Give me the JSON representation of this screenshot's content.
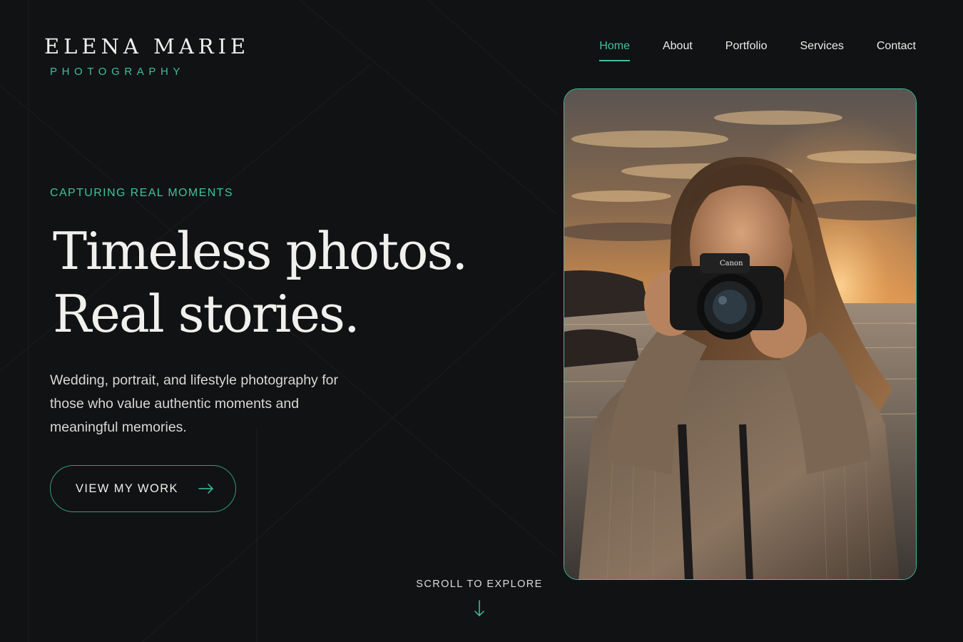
{
  "brand": {
    "name": "ELENA MARIE",
    "tagline": "PHOTOGRAPHY",
    "accent_color": "#3fc29b"
  },
  "nav": {
    "items": [
      {
        "label": "Home",
        "active": true
      },
      {
        "label": "About",
        "active": false
      },
      {
        "label": "Portfolio",
        "active": false
      },
      {
        "label": "Services",
        "active": false
      },
      {
        "label": "Contact",
        "active": false
      }
    ]
  },
  "hero": {
    "eyebrow": "CAPTURING REAL MOMENTS",
    "headline_line1": "Timeless photos.",
    "headline_line2": "Real stories.",
    "lead": "Wedding, portrait, and lifestyle photography for those who value authentic moments and meaningful memories.",
    "cta_label": "VIEW MY WORK",
    "cta_icon": "arrow-right-icon"
  },
  "photo": {
    "camera_brand": "Canon"
  },
  "scroll": {
    "label": "SCROLL TO EXPLORE",
    "icon": "arrow-down-icon"
  }
}
